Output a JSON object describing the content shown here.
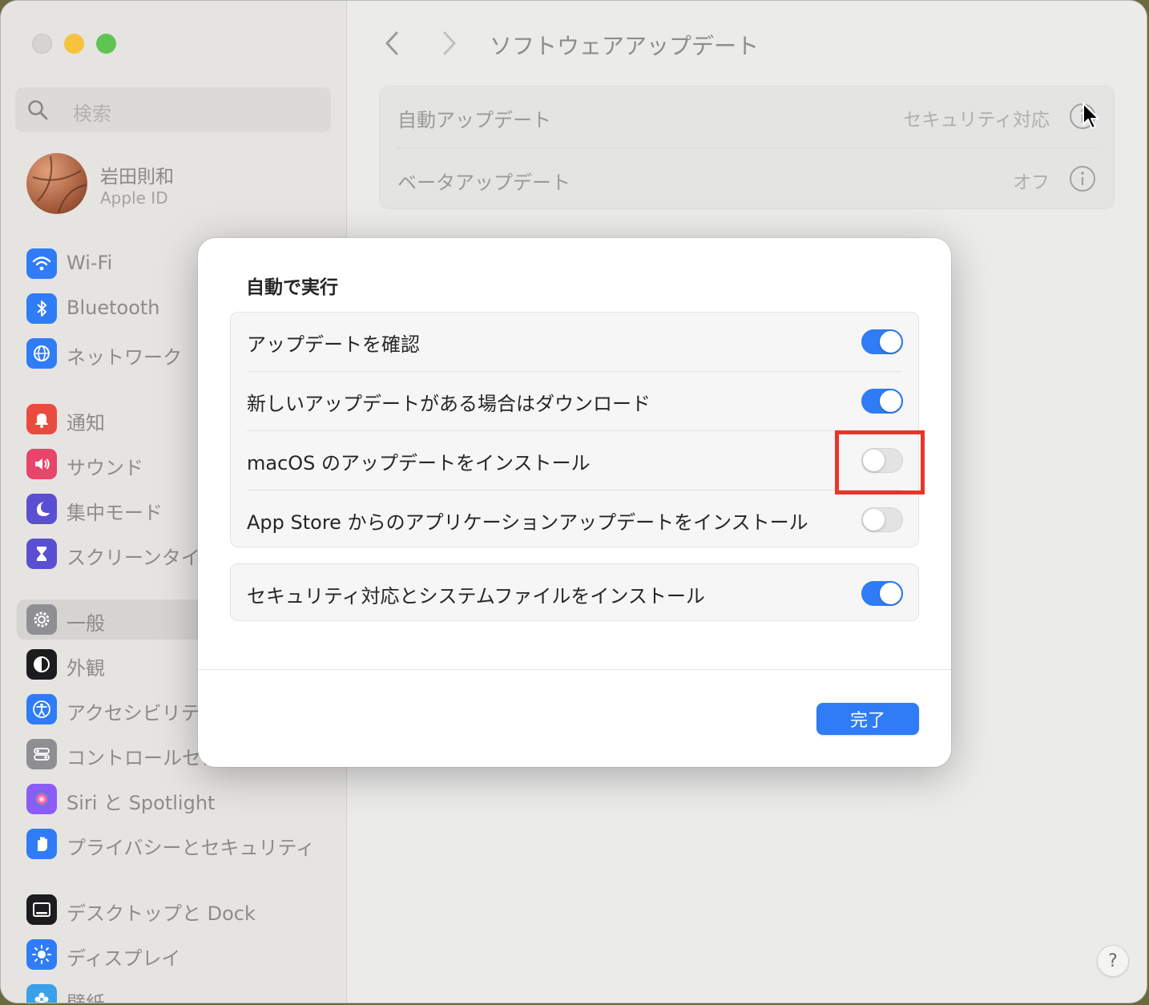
{
  "sidebar": {
    "search_placeholder": "検索",
    "account": {
      "name": "岩田則和",
      "subtitle": "Apple ID"
    },
    "items": [
      {
        "label": "Wi-Fi",
        "icon": "wifi-icon",
        "color": "#2f7cf6"
      },
      {
        "label": "Bluetooth",
        "icon": "bluetooth-icon",
        "color": "#2f7cf6"
      },
      {
        "label": "ネットワーク",
        "icon": "globe-icon",
        "color": "#2f7cf6"
      },
      {
        "label": "通知",
        "icon": "bell-icon",
        "color": "#ea4b3f"
      },
      {
        "label": "サウンド",
        "icon": "speaker-icon",
        "color": "#e8456b"
      },
      {
        "label": "集中モード",
        "icon": "moon-icon",
        "color": "#5a4fd0"
      },
      {
        "label": "スクリーンタイム",
        "icon": "hourglass-icon",
        "color": "#5a4fd0"
      },
      {
        "label": "一般",
        "icon": "gear-icon",
        "color": "#8e8e93",
        "selected": true
      },
      {
        "label": "外観",
        "icon": "appearance-icon",
        "color": "#1c1c1e"
      },
      {
        "label": "アクセシビリティ",
        "icon": "accessibility-icon",
        "color": "#2f7cf6"
      },
      {
        "label": "コントロールセンター",
        "icon": "control-center-icon",
        "color": "#8e8e93"
      },
      {
        "label": "Siri と Spotlight",
        "icon": "siri-icon",
        "color": "#8b5cf6"
      },
      {
        "label": "プライバシーとセキュリティ",
        "icon": "hand-icon",
        "color": "#2f7cf6"
      },
      {
        "label": "デスクトップと Dock",
        "icon": "dock-icon",
        "color": "#1c1c1e"
      },
      {
        "label": "ディスプレイ",
        "icon": "sun-icon",
        "color": "#2f7cf6"
      },
      {
        "label": "壁紙",
        "icon": "wallpaper-icon",
        "color": "#3aa0e8"
      }
    ]
  },
  "main": {
    "title": "ソフトウェアアップデート",
    "rows": [
      {
        "label": "自動アップデート",
        "value": "セキュリティ対応"
      },
      {
        "label": "ベータアップデート",
        "value": "オフ"
      }
    ],
    "help_label": "?"
  },
  "sheet": {
    "title": "自動で実行",
    "toggles": [
      {
        "label": "アップデートを確認",
        "on": true
      },
      {
        "label": "新しいアップデートがある場合はダウンロード",
        "on": true
      },
      {
        "label": "macOS のアップデートをインストール",
        "on": false,
        "highlighted": true
      },
      {
        "label": "App Store からのアプリケーションアップデートをインストール",
        "on": false
      }
    ],
    "security_toggle": {
      "label": "セキュリティ対応とシステムファイルをインストール",
      "on": true
    },
    "done_label": "完了"
  },
  "colors": {
    "accent": "#2f7cf6",
    "highlight": "#e8352a"
  }
}
